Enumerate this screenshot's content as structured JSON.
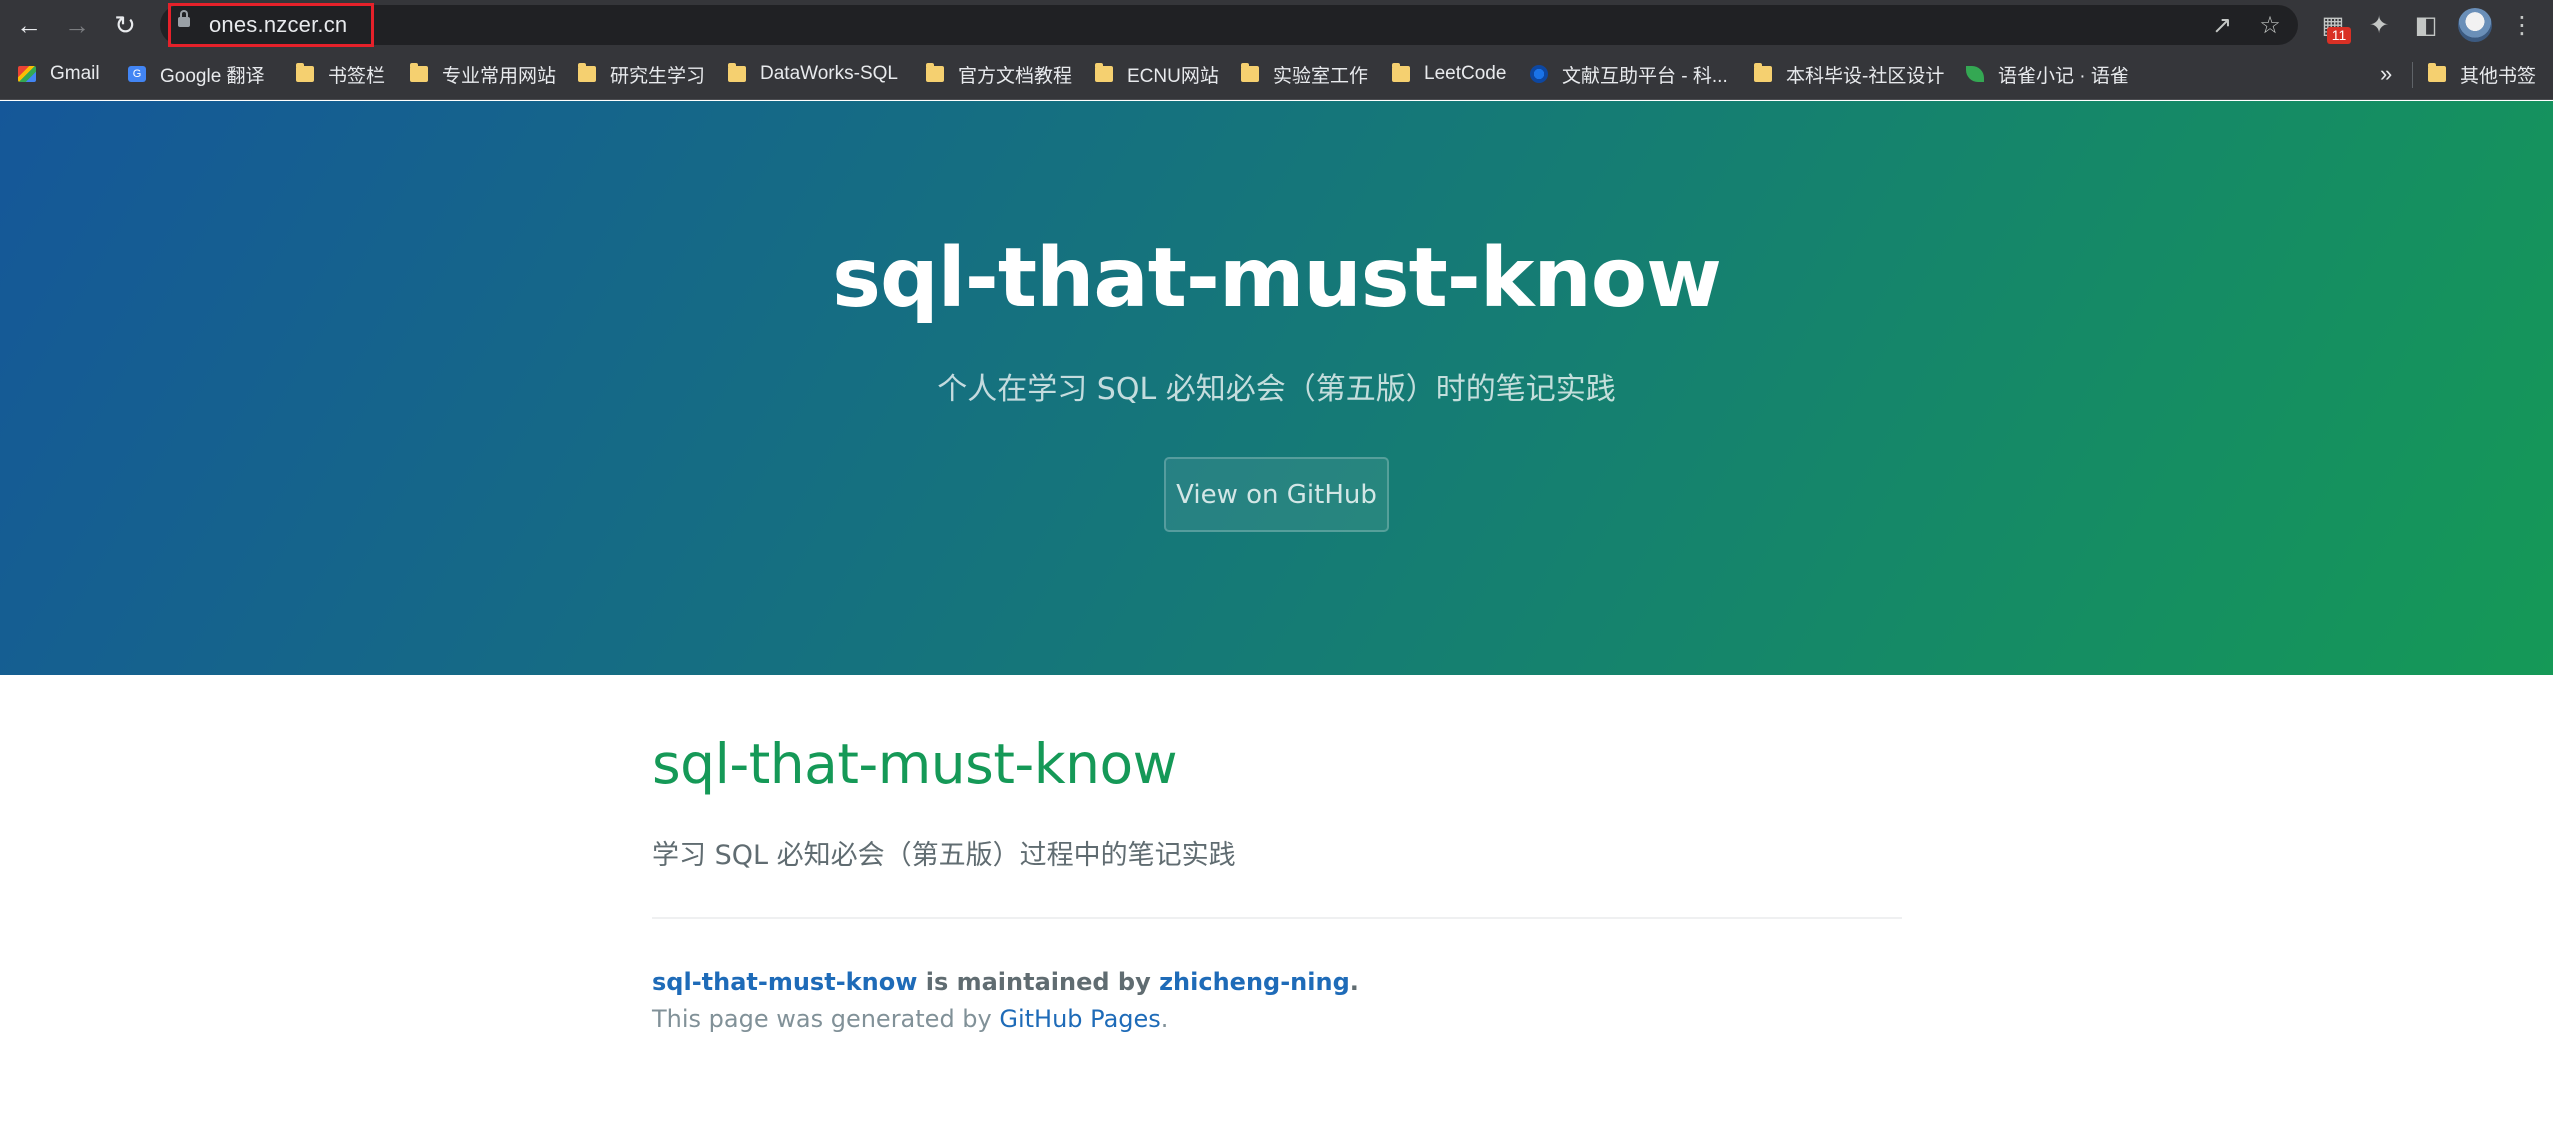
{
  "browser": {
    "url": "ones.nzcer.cn",
    "extension_badge": "11",
    "bookmarks": [
      {
        "label": "Gmail",
        "icon": "gmail-icon"
      },
      {
        "label": "Google 翻译",
        "icon": "google-translate-icon"
      },
      {
        "label": "书签栏",
        "icon": "folder-icon"
      },
      {
        "label": "专业常用网站",
        "icon": "folder-icon"
      },
      {
        "label": "研究生学习",
        "icon": "folder-icon"
      },
      {
        "label": "DataWorks-SQL",
        "icon": "folder-icon"
      },
      {
        "label": "官方文档教程",
        "icon": "folder-icon"
      },
      {
        "label": "ECNU网站",
        "icon": "folder-icon"
      },
      {
        "label": "实验室工作",
        "icon": "folder-icon"
      },
      {
        "label": "LeetCode",
        "icon": "folder-icon"
      },
      {
        "label": "文献互助平台 - 科...",
        "icon": "globe-icon"
      },
      {
        "label": "本科毕设-社区设计",
        "icon": "folder-icon"
      },
      {
        "label": "语雀小记 · 语雀",
        "icon": "leaf-icon"
      }
    ],
    "more_chevron": "»",
    "other_bookmarks": "其他书签"
  },
  "hero": {
    "title": "sql-that-must-know",
    "tagline": "个人在学习 SQL 必知必会（第五版）时的笔记实践",
    "github_button": "View on GitHub"
  },
  "main": {
    "heading": "sql-that-must-know",
    "description": "学习 SQL 必知必会（第五版）过程中的笔记实践",
    "footer": {
      "project_link": "sql-that-must-know",
      "maintained_by": " is maintained by ",
      "author_link": "zhicheng-ning",
      "period": ".",
      "generated_prefix": "This page was generated by ",
      "generator_link": "GitHub Pages",
      "generated_suffix": "."
    }
  },
  "colors": {
    "hero_gradient_start": "#155799",
    "hero_gradient_end": "#159957",
    "heading": "#159957",
    "link": "#1e6bb8",
    "url_highlight_border": "#e5212a"
  }
}
